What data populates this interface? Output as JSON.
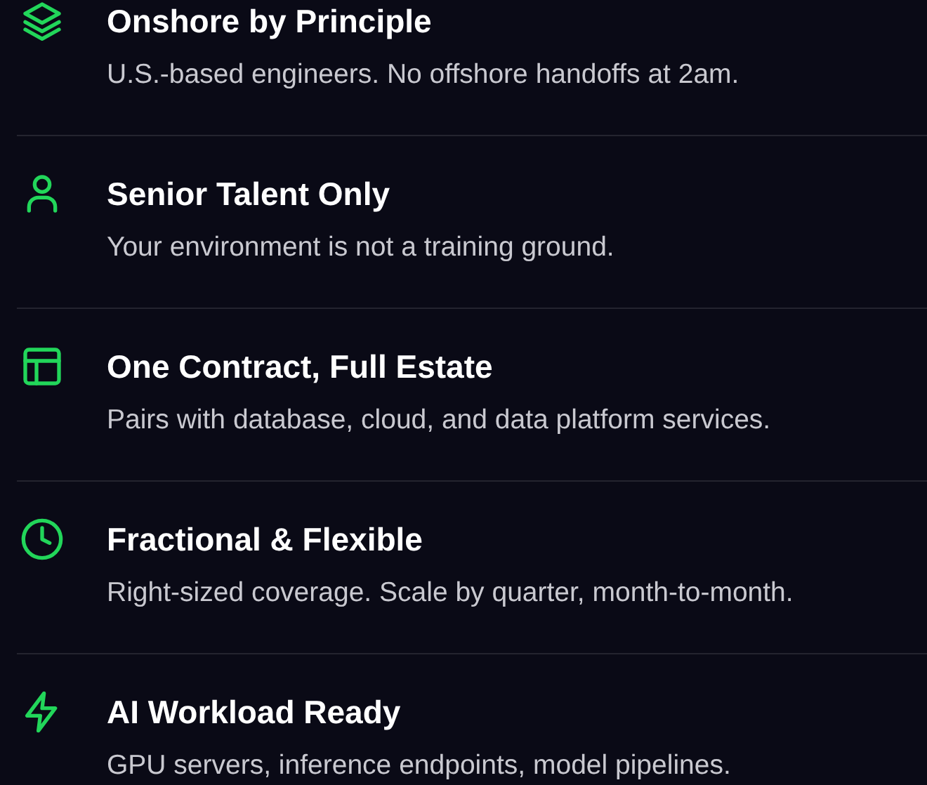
{
  "features": [
    {
      "title": "Onshore by Principle",
      "description": "U.S.-based engineers. No offshore handoffs at 2am."
    },
    {
      "title": "Senior Talent Only",
      "description": "Your environment is not a training ground."
    },
    {
      "title": "One Contract, Full Estate",
      "description": "Pairs with database, cloud, and data platform services."
    },
    {
      "title": "Fractional & Flexible",
      "description": "Right-sized coverage. Scale by quarter, month-to-month."
    },
    {
      "title": "AI Workload Ready",
      "description": "GPU servers, inference endpoints, model pipelines."
    }
  ]
}
